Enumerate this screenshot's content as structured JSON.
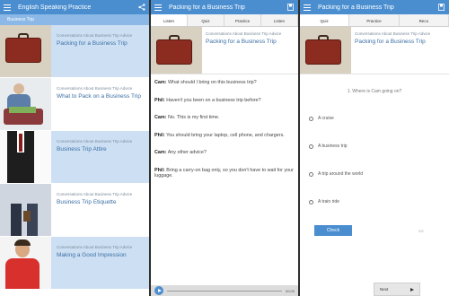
{
  "screen1": {
    "appbar_title": "English Speaking Practice",
    "subbar": "Business Trip",
    "lessons": [
      {
        "category": "Conversations About Business Trip Advice",
        "title": "Packing for a Business Trip"
      },
      {
        "category": "Conversations About Business Trip Advice",
        "title": "What to Pack on a Business Trip"
      },
      {
        "category": "Conversations About Business Trip Advice",
        "title": "Business Trip Attire"
      },
      {
        "category": "Conversations About Business Trip Advice",
        "title": "Business Trip Etiquette"
      },
      {
        "category": "Conversations About Business Trip Advice",
        "title": "Making a Good Impression"
      }
    ]
  },
  "screen2": {
    "appbar_title": "Packing for a Business Trip",
    "tabs": [
      "Listen",
      "Quiz",
      "Practice",
      "Listen"
    ],
    "header_category": "Conversations About Business Trip Advice",
    "header_title": "Packing for a Business Trip",
    "dialog": [
      {
        "speaker": "Cam:",
        "text": "What should I bring on this business trip?"
      },
      {
        "speaker": "Phil:",
        "text": "Haven't you been on a business trip before?"
      },
      {
        "speaker": "Cam:",
        "text": "No. This is my first time."
      },
      {
        "speaker": "Phil:",
        "text": "You should bring your laptop, cell phone, and chargers."
      },
      {
        "speaker": "Cam:",
        "text": "Any other advice?"
      },
      {
        "speaker": "Phil:",
        "text": "Bring a carry-on bag only, so you don't have to wait for your luggage."
      }
    ],
    "audio_time": "00:00"
  },
  "screen3": {
    "appbar_title": "Packing for a Business Trip",
    "tabs": [
      "Quiz",
      "Practice",
      "Reco"
    ],
    "header_category": "Conversations About Business Trip Advice",
    "header_title": "Packing for a Business Trip",
    "question": "1. Where is Cam going on?",
    "options": [
      "A cruise",
      "A business trip",
      "A trip around the world",
      "A train ride"
    ],
    "check_label": "Check",
    "score": "0/5",
    "next_label": "Next"
  },
  "colors": {
    "appbar": "#4a8ed0",
    "subbar": "#8bb8e6",
    "lesson_highlight": "#cde0f3"
  },
  "icons": [
    "menu-icon",
    "share-icon",
    "bookmark-icon",
    "play-icon",
    "next-arrow-icon"
  ]
}
